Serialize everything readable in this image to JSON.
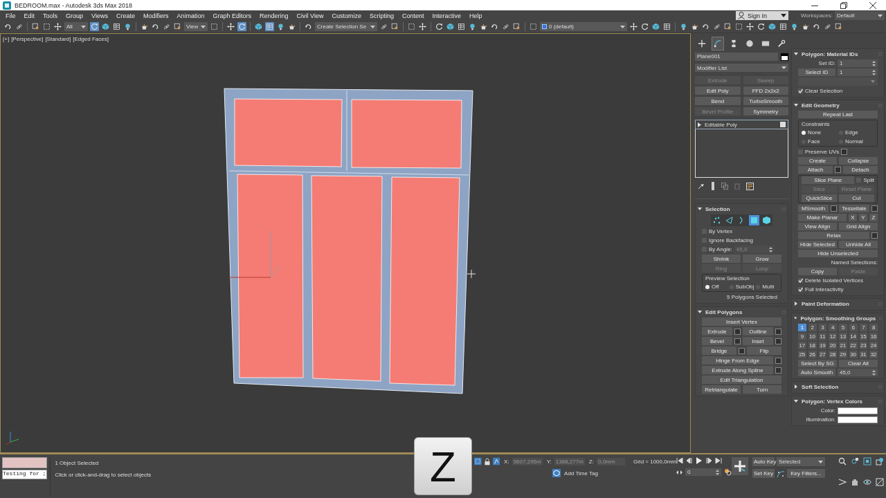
{
  "window": {
    "title": "BEDROOM.max - Autodesk 3ds Max 2018"
  },
  "menu": [
    "File",
    "Edit",
    "Tools",
    "Group",
    "Views",
    "Create",
    "Modifiers",
    "Animation",
    "Graph Editors",
    "Rendering",
    "Civil View",
    "Customize",
    "Scripting",
    "Content",
    "Interactive",
    "Help"
  ],
  "account": {
    "label": "Sign In"
  },
  "workspace": {
    "label": "Workspaces:",
    "value": "Default"
  },
  "toolbar": [
    {
      "kind": "icon",
      "selected": false
    },
    {
      "kind": "icon",
      "selected": false
    },
    {
      "kind": "sep"
    },
    {
      "kind": "icon",
      "selected": false
    },
    {
      "kind": "icon",
      "selected": false
    },
    {
      "kind": "icon",
      "selected": false
    },
    {
      "kind": "dropdown",
      "value": "All"
    },
    {
      "kind": "icon",
      "selected": true
    },
    {
      "kind": "icon",
      "selected": false
    },
    {
      "kind": "icon",
      "selected": false
    },
    {
      "kind": "icon",
      "selected": false
    },
    {
      "kind": "sep"
    },
    {
      "kind": "icon",
      "selected": false
    },
    {
      "kind": "icon",
      "selected": false
    },
    {
      "kind": "icon",
      "selected": false
    },
    {
      "kind": "icon",
      "selected": false
    },
    {
      "kind": "dropdown",
      "value": "View"
    },
    {
      "kind": "icon",
      "selected": false
    },
    {
      "kind": "sep"
    },
    {
      "kind": "icon",
      "selected": false
    },
    {
      "kind": "icon",
      "selected": true
    },
    {
      "kind": "sep"
    },
    {
      "kind": "icon",
      "selected": false
    },
    {
      "kind": "icon",
      "selected": true
    },
    {
      "kind": "icon",
      "selected": false
    },
    {
      "kind": "icon",
      "selected": false
    },
    {
      "kind": "sep"
    },
    {
      "kind": "icon",
      "selected": false
    },
    {
      "kind": "dropdown",
      "value": "Create Selection Se"
    },
    {
      "kind": "icon",
      "selected": false
    },
    {
      "kind": "icon",
      "selected": false
    },
    {
      "kind": "sep"
    },
    {
      "kind": "icon",
      "selected": false
    },
    {
      "kind": "icon",
      "selected": false
    },
    {
      "kind": "sep"
    },
    {
      "kind": "icon",
      "selected": false
    },
    {
      "kind": "icon",
      "selected": false
    },
    {
      "kind": "icon",
      "selected": false
    },
    {
      "kind": "icon",
      "selected": false
    },
    {
      "kind": "icon",
      "selected": false
    },
    {
      "kind": "icon",
      "selected": false
    },
    {
      "kind": "icon",
      "selected": false
    },
    {
      "kind": "icon",
      "selected": false
    },
    {
      "kind": "sep"
    },
    {
      "kind": "icon",
      "selected": false
    },
    {
      "kind": "layer",
      "value": "0 (default)"
    },
    {
      "kind": "icon",
      "selected": false
    },
    {
      "kind": "icon",
      "selected": false
    },
    {
      "kind": "icon",
      "selected": false
    },
    {
      "kind": "icon",
      "selected": false
    },
    {
      "kind": "sep"
    },
    {
      "kind": "icon",
      "selected": false
    },
    {
      "kind": "icon",
      "selected": false
    },
    {
      "kind": "icon",
      "selected": false
    },
    {
      "kind": "icon",
      "selected": false
    },
    {
      "kind": "icon",
      "selected": false
    },
    {
      "kind": "icon",
      "selected": false
    },
    {
      "kind": "icon",
      "selected": false
    },
    {
      "kind": "icon",
      "selected": false
    },
    {
      "kind": "icon",
      "selected": false
    },
    {
      "kind": "icon",
      "selected": false
    },
    {
      "kind": "icon",
      "selected": false
    },
    {
      "kind": "icon",
      "selected": false
    },
    {
      "kind": "icon",
      "selected": false
    },
    {
      "kind": "icon",
      "selected": false
    },
    {
      "kind": "icon",
      "selected": false
    }
  ],
  "viewport": {
    "labels": [
      "[+]",
      "[Perspective]",
      "[Standard]",
      "[Edged Faces]"
    ]
  },
  "command_panel": {
    "tabs": [
      {
        "selected": false
      },
      {
        "selected": true
      },
      {
        "selected": false
      },
      {
        "selected": false
      },
      {
        "selected": false
      },
      {
        "selected": false
      }
    ],
    "object_name": "Plane001",
    "modifier_list": "Modifier List",
    "modifier_buttons": [
      {
        "label": "Extrude",
        "disabled": true
      },
      {
        "label": "Sweep",
        "disabled": true
      },
      {
        "label": "Edit Poly",
        "disabled": false
      },
      {
        "label": "FFD 2x2x2",
        "disabled": false
      },
      {
        "label": "Bend",
        "disabled": false
      },
      {
        "label": "TurboSmooth",
        "disabled": false
      },
      {
        "label": "Bevel Profile",
        "disabled": true
      },
      {
        "label": "Symmetry",
        "disabled": false
      }
    ],
    "stack": [
      {
        "label": "Editable Poly",
        "selected": true
      }
    ]
  },
  "rollouts_left": [
    {
      "title": "Selection",
      "expanded": true,
      "rows": [
        [
          {
            "kind": "subobj",
            "icons": [
              {
                "selected": false
              },
              {
                "selected": false
              },
              {
                "selected": false
              },
              {
                "selected": true
              },
              {
                "selected": false
              }
            ]
          }
        ],
        [
          {
            "kind": "checkbox",
            "label": "By Vertex",
            "checked": false
          }
        ],
        [
          {
            "kind": "checkbox",
            "label": "Ignore Backfacing",
            "checked": false
          }
        ],
        [
          {
            "kind": "checkbox",
            "label": "By Angle:",
            "checked": false
          },
          {
            "kind": "spinner",
            "value": "45,0",
            "disabled": true
          }
        ],
        [
          {
            "kind": "button",
            "label": "Shrink",
            "disabled": false
          },
          {
            "kind": "button",
            "label": "Grow",
            "disabled": false
          }
        ],
        [
          {
            "kind": "button",
            "label": "Ring",
            "disabled": true
          },
          {
            "kind": "button",
            "label": "Loop",
            "disabled": true
          }
        ],
        [
          {
            "kind": "group",
            "title": "Preview Selection",
            "rows": [
              [
                {
                  "kind": "radio",
                  "label": "Off",
                  "selected": true
                },
                {
                  "kind": "radio",
                  "label": "SubObj",
                  "selected": false
                },
                {
                  "kind": "radio",
                  "label": "Multi",
                  "selected": false
                }
              ]
            ]
          }
        ],
        [
          {
            "kind": "text",
            "text": "5 Polygons Selected"
          }
        ]
      ]
    },
    {
      "title": "Edit Polygons",
      "expanded": true,
      "rows": [
        [
          {
            "kind": "button",
            "label": "Insert Vertex",
            "disabled": false
          }
        ],
        [
          {
            "kind": "button",
            "label": "Extrude",
            "disabled": false
          },
          {
            "kind": "box"
          },
          {
            "kind": "button",
            "label": "Outline",
            "disabled": false
          },
          {
            "kind": "box"
          }
        ],
        [
          {
            "kind": "button",
            "label": "Bevel",
            "disabled": false
          },
          {
            "kind": "box"
          },
          {
            "kind": "button",
            "label": "Inset",
            "disabled": false
          },
          {
            "kind": "box"
          }
        ],
        [
          {
            "kind": "button",
            "label": "Bridge",
            "disabled": false
          },
          {
            "kind": "box"
          },
          {
            "kind": "button",
            "label": "Flip",
            "disabled": false
          }
        ],
        [
          {
            "kind": "button",
            "label": "Hinge From Edge",
            "disabled": false
          },
          {
            "kind": "box"
          }
        ],
        [
          {
            "kind": "button",
            "label": "Extrude Along Spline",
            "disabled": false
          },
          {
            "kind": "box"
          }
        ],
        [
          {
            "kind": "button",
            "label": "Edit Triangulation",
            "disabled": false
          }
        ],
        [
          {
            "kind": "button",
            "label": "Retriangulate",
            "disabled": false
          },
          {
            "kind": "button",
            "label": "Turn",
            "disabled": false
          }
        ]
      ]
    }
  ],
  "rollouts_right": [
    {
      "title": "Polygon: Material IDs",
      "expanded": true,
      "rows": [
        [
          {
            "kind": "label",
            "text": "Set ID:"
          },
          {
            "kind": "spinner",
            "value": "1",
            "disabled": false
          }
        ],
        [
          {
            "kind": "button",
            "label": "Select ID",
            "disabled": false
          },
          {
            "kind": "spinner",
            "value": "1",
            "disabled": false
          }
        ],
        [
          {
            "kind": "dropdown",
            "disabled": true
          }
        ],
        [
          {
            "kind": "checkbox",
            "label": "Clear Selection",
            "checked": true
          }
        ]
      ]
    },
    {
      "title": "Edit Geometry",
      "expanded": true,
      "rows": [
        [
          {
            "kind": "button",
            "label": "Repeat Last",
            "disabled": false
          }
        ],
        [
          {
            "kind": "group",
            "title": "Constraints",
            "rows": [
              [
                {
                  "kind": "radio",
                  "label": "None",
                  "selected": true
                },
                {
                  "kind": "radio",
                  "label": "Edge",
                  "selected": false
                }
              ],
              [
                {
                  "kind": "radio",
                  "label": "Face",
                  "selected": false
                },
                {
                  "kind": "radio",
                  "label": "Normal",
                  "selected": false
                }
              ]
            ]
          }
        ],
        [
          {
            "kind": "checkbox",
            "label": "Preserve UVs",
            "checked": false
          },
          {
            "kind": "box"
          }
        ],
        [
          {
            "kind": "button",
            "label": "Create",
            "disabled": false
          },
          {
            "kind": "button",
            "label": "Collapse",
            "disabled": false
          }
        ],
        [
          {
            "kind": "button",
            "label": "Attach",
            "disabled": false
          },
          {
            "kind": "box"
          },
          {
            "kind": "button",
            "label": "Detach",
            "disabled": false
          }
        ],
        [
          {
            "kind": "group",
            "rows": [
              [
                {
                  "kind": "button",
                  "label": "Slice Plane",
                  "disabled": false
                },
                {
                  "kind": "checkbox",
                  "label": "Split",
                  "checked": false
                }
              ],
              [
                {
                  "kind": "button",
                  "label": "Slice",
                  "disabled": true
                },
                {
                  "kind": "button",
                  "label": "Reset Plane",
                  "disabled": true
                }
              ],
              [
                {
                  "kind": "button",
                  "label": "QuickSlice",
                  "disabled": false
                },
                {
                  "kind": "button",
                  "label": "Cut",
                  "disabled": false
                }
              ]
            ]
          }
        ],
        [
          {
            "kind": "button",
            "label": "MSmooth",
            "disabled": false
          },
          {
            "kind": "box"
          },
          {
            "kind": "button",
            "label": "Tessellate",
            "disabled": false
          },
          {
            "kind": "box"
          }
        ],
        [
          {
            "kind": "button",
            "label": "Make Planar",
            "disabled": false
          },
          {
            "kind": "small",
            "label": "X"
          },
          {
            "kind": "small",
            "label": "Y"
          },
          {
            "kind": "small",
            "label": "Z"
          }
        ],
        [
          {
            "kind": "button",
            "label": "View Align",
            "disabled": false
          },
          {
            "kind": "button",
            "label": "Grid Align",
            "disabled": false
          }
        ],
        [
          {
            "kind": "button",
            "label": "Relax",
            "disabled": false
          },
          {
            "kind": "box"
          }
        ],
        [
          {
            "kind": "button",
            "label": "Hide Selected",
            "disabled": false
          },
          {
            "kind": "button",
            "label": "Unhide All",
            "disabled": false
          }
        ],
        [
          {
            "kind": "button",
            "label": "Hide Unselected",
            "disabled": false
          }
        ],
        [
          {
            "kind": "label",
            "text": "Named Selections:"
          }
        ],
        [
          {
            "kind": "button",
            "label": "Copy",
            "disabled": false
          },
          {
            "kind": "button",
            "label": "Paste",
            "disabled": true
          }
        ],
        [
          {
            "kind": "checkbox",
            "label": "Delete Isolated Vertices",
            "checked": true
          }
        ],
        [
          {
            "kind": "checkbox",
            "label": "Full Interactivity",
            "checked": true
          }
        ]
      ]
    },
    {
      "title": "Paint Deformation",
      "expanded": false
    },
    {
      "title": "Polygon: Smoothing Groups",
      "expanded": true,
      "rows": [
        [
          {
            "kind": "grid",
            "cells": [
              {
                "label": "1",
                "selected": true
              },
              {
                "label": "2",
                "selected": false
              },
              {
                "label": "3",
                "selected": false
              },
              {
                "label": "4",
                "selected": false
              },
              {
                "label": "5",
                "selected": false
              },
              {
                "label": "6",
                "selected": false
              },
              {
                "label": "7",
                "selected": false
              },
              {
                "label": "8",
                "selected": false
              },
              {
                "label": "9",
                "selected": false
              },
              {
                "label": "10",
                "selected": false
              },
              {
                "label": "11",
                "selected": false
              },
              {
                "label": "12",
                "selected": false
              },
              {
                "label": "13",
                "selected": false
              },
              {
                "label": "14",
                "selected": false
              },
              {
                "label": "15",
                "selected": false
              },
              {
                "label": "16",
                "selected": false
              },
              {
                "label": "17",
                "selected": false
              },
              {
                "label": "18",
                "selected": false
              },
              {
                "label": "19",
                "selected": false
              },
              {
                "label": "20",
                "selected": false
              },
              {
                "label": "21",
                "selected": false
              },
              {
                "label": "22",
                "selected": false
              },
              {
                "label": "23",
                "selected": false
              },
              {
                "label": "24",
                "selected": false
              },
              {
                "label": "25",
                "selected": false
              },
              {
                "label": "26",
                "selected": false
              },
              {
                "label": "27",
                "selected": false
              },
              {
                "label": "28",
                "selected": false
              },
              {
                "label": "29",
                "selected": false
              },
              {
                "label": "30",
                "selected": false
              },
              {
                "label": "31",
                "selected": false
              },
              {
                "label": "32",
                "selected": false
              }
            ]
          }
        ],
        [
          {
            "kind": "button",
            "label": "Select By SG",
            "disabled": false
          },
          {
            "kind": "button",
            "label": "Clear All",
            "disabled": false
          }
        ],
        [
          {
            "kind": "button",
            "label": "Auto Smooth",
            "disabled": false
          },
          {
            "kind": "spinner",
            "value": "45,0",
            "disabled": false
          }
        ]
      ]
    },
    {
      "title": "Soft Selection",
      "expanded": false
    },
    {
      "title": "Polygon: Vertex Colors",
      "expanded": true,
      "rows": [
        [
          {
            "kind": "label",
            "text": "Color:"
          },
          {
            "kind": "swatch",
            "color": "#ffffff"
          }
        ],
        [
          {
            "kind": "label",
            "text": "Illumination:"
          },
          {
            "kind": "swatch",
            "color": "#ffffff"
          }
        ]
      ]
    }
  ],
  "status": {
    "listener_value": "Testing for ;",
    "selection": "1 Object Selected",
    "prompt": "Click or click-and-drag to select objects"
  },
  "coords": [
    {
      "label": "X:",
      "value": "5607,295m"
    },
    {
      "label": "Y:",
      "value": "1388,277m"
    },
    {
      "label": "Z:",
      "value": "0,0mm"
    }
  ],
  "grid": "Grid = 1000,0mm",
  "time_tag": "Add Time Tag",
  "frame": "0",
  "keys": {
    "auto_key": "Auto Key",
    "mode": "Selected",
    "set_key": "Set Key",
    "filters": "Key Filters..."
  },
  "key_overlay": "Z"
}
